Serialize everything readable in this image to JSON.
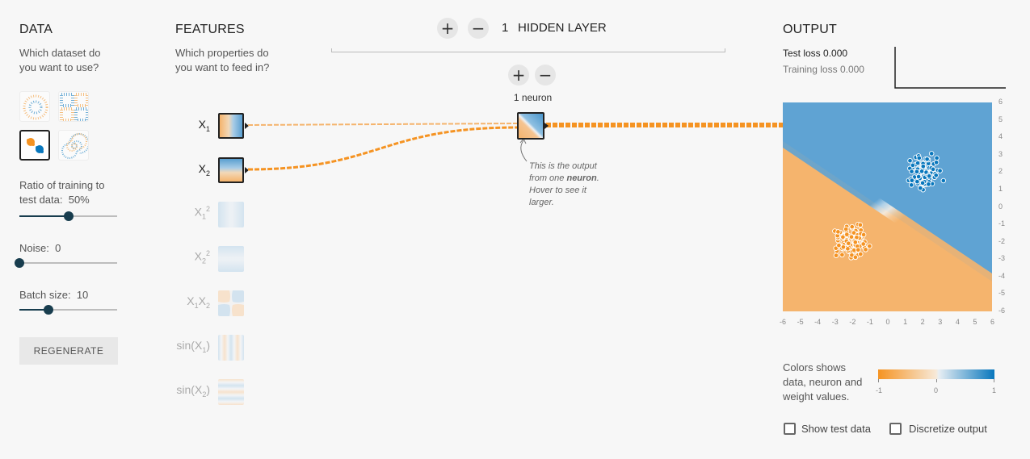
{
  "data_panel": {
    "title": "DATA",
    "subtitle_line1": "Which dataset do",
    "subtitle_line2": "you want to use?",
    "datasets": [
      "circle-dataset",
      "xor-dataset",
      "gaussian-dataset",
      "spiral-dataset"
    ],
    "selected_dataset": "gaussian-dataset",
    "ratio_label_line1": "Ratio of training to",
    "ratio_label_line2": "test data:",
    "ratio_value": "50%",
    "ratio_fraction": 0.5,
    "noise_label": "Noise:",
    "noise_value": "0",
    "noise_fraction": 0.0,
    "batch_label": "Batch size:",
    "batch_value": "10",
    "batch_fraction": 0.3,
    "regenerate_label": "REGENERATE"
  },
  "features_panel": {
    "title": "FEATURES",
    "subtitle_line1": "Which properties do",
    "subtitle_line2": "you want to feed in?",
    "features": [
      {
        "base": "X",
        "sub": "1",
        "sup": "",
        "active": true
      },
      {
        "base": "X",
        "sub": "2",
        "sup": "",
        "active": true
      },
      {
        "base": "X",
        "sub": "1",
        "sup": "2",
        "active": false
      },
      {
        "base": "X",
        "sub": "2",
        "sup": "2",
        "active": false
      },
      {
        "base": "X",
        "sub": "1",
        "base2": "X",
        "sub2": "2",
        "active": false
      },
      {
        "base": "sin(X",
        "sub": "1",
        "tail": ")",
        "active": false
      },
      {
        "base": "sin(X",
        "sub": "2",
        "tail": ")",
        "active": false
      }
    ]
  },
  "network": {
    "hidden_layer_count": "1",
    "hidden_layer_label": "HIDDEN LAYER",
    "add_layer_symbol": "+",
    "remove_layer_symbol": "−",
    "add_neuron_symbol": "+",
    "remove_neuron_symbol": "−",
    "neuron_count_label": "1 neuron",
    "note_line1": "This is the output",
    "note_line2_pre": "from one ",
    "note_line2_bold": "neuron",
    "note_line2_post": ".",
    "note_line3": "Hover to see it",
    "note_line4": "larger.",
    "colors": {
      "orange": "#f59322",
      "blue": "#0877bd"
    }
  },
  "output_panel": {
    "title": "OUTPUT",
    "test_loss_label": "Test loss",
    "test_loss_value": "0.000",
    "training_loss_label": "Training loss",
    "training_loss_value": "0.000",
    "y_ticks": [
      "6",
      "5",
      "4",
      "3",
      "2",
      "1",
      "0",
      "-1",
      "-2",
      "-3",
      "-4",
      "-5",
      "-6"
    ],
    "x_ticks": [
      "-6",
      "-5",
      "-4",
      "-3",
      "-2",
      "-1",
      "0",
      "1",
      "2",
      "3",
      "4",
      "5",
      "6"
    ],
    "legend_text_line1": "Colors shows",
    "legend_text_line2": "data, neuron and",
    "legend_text_line3": "weight values.",
    "legend_scale": [
      "-1",
      "0",
      "1"
    ],
    "show_test_data_label": "Show test data",
    "discretize_label": "Discretize output",
    "show_test_data_checked": false,
    "discretize_checked": false
  }
}
